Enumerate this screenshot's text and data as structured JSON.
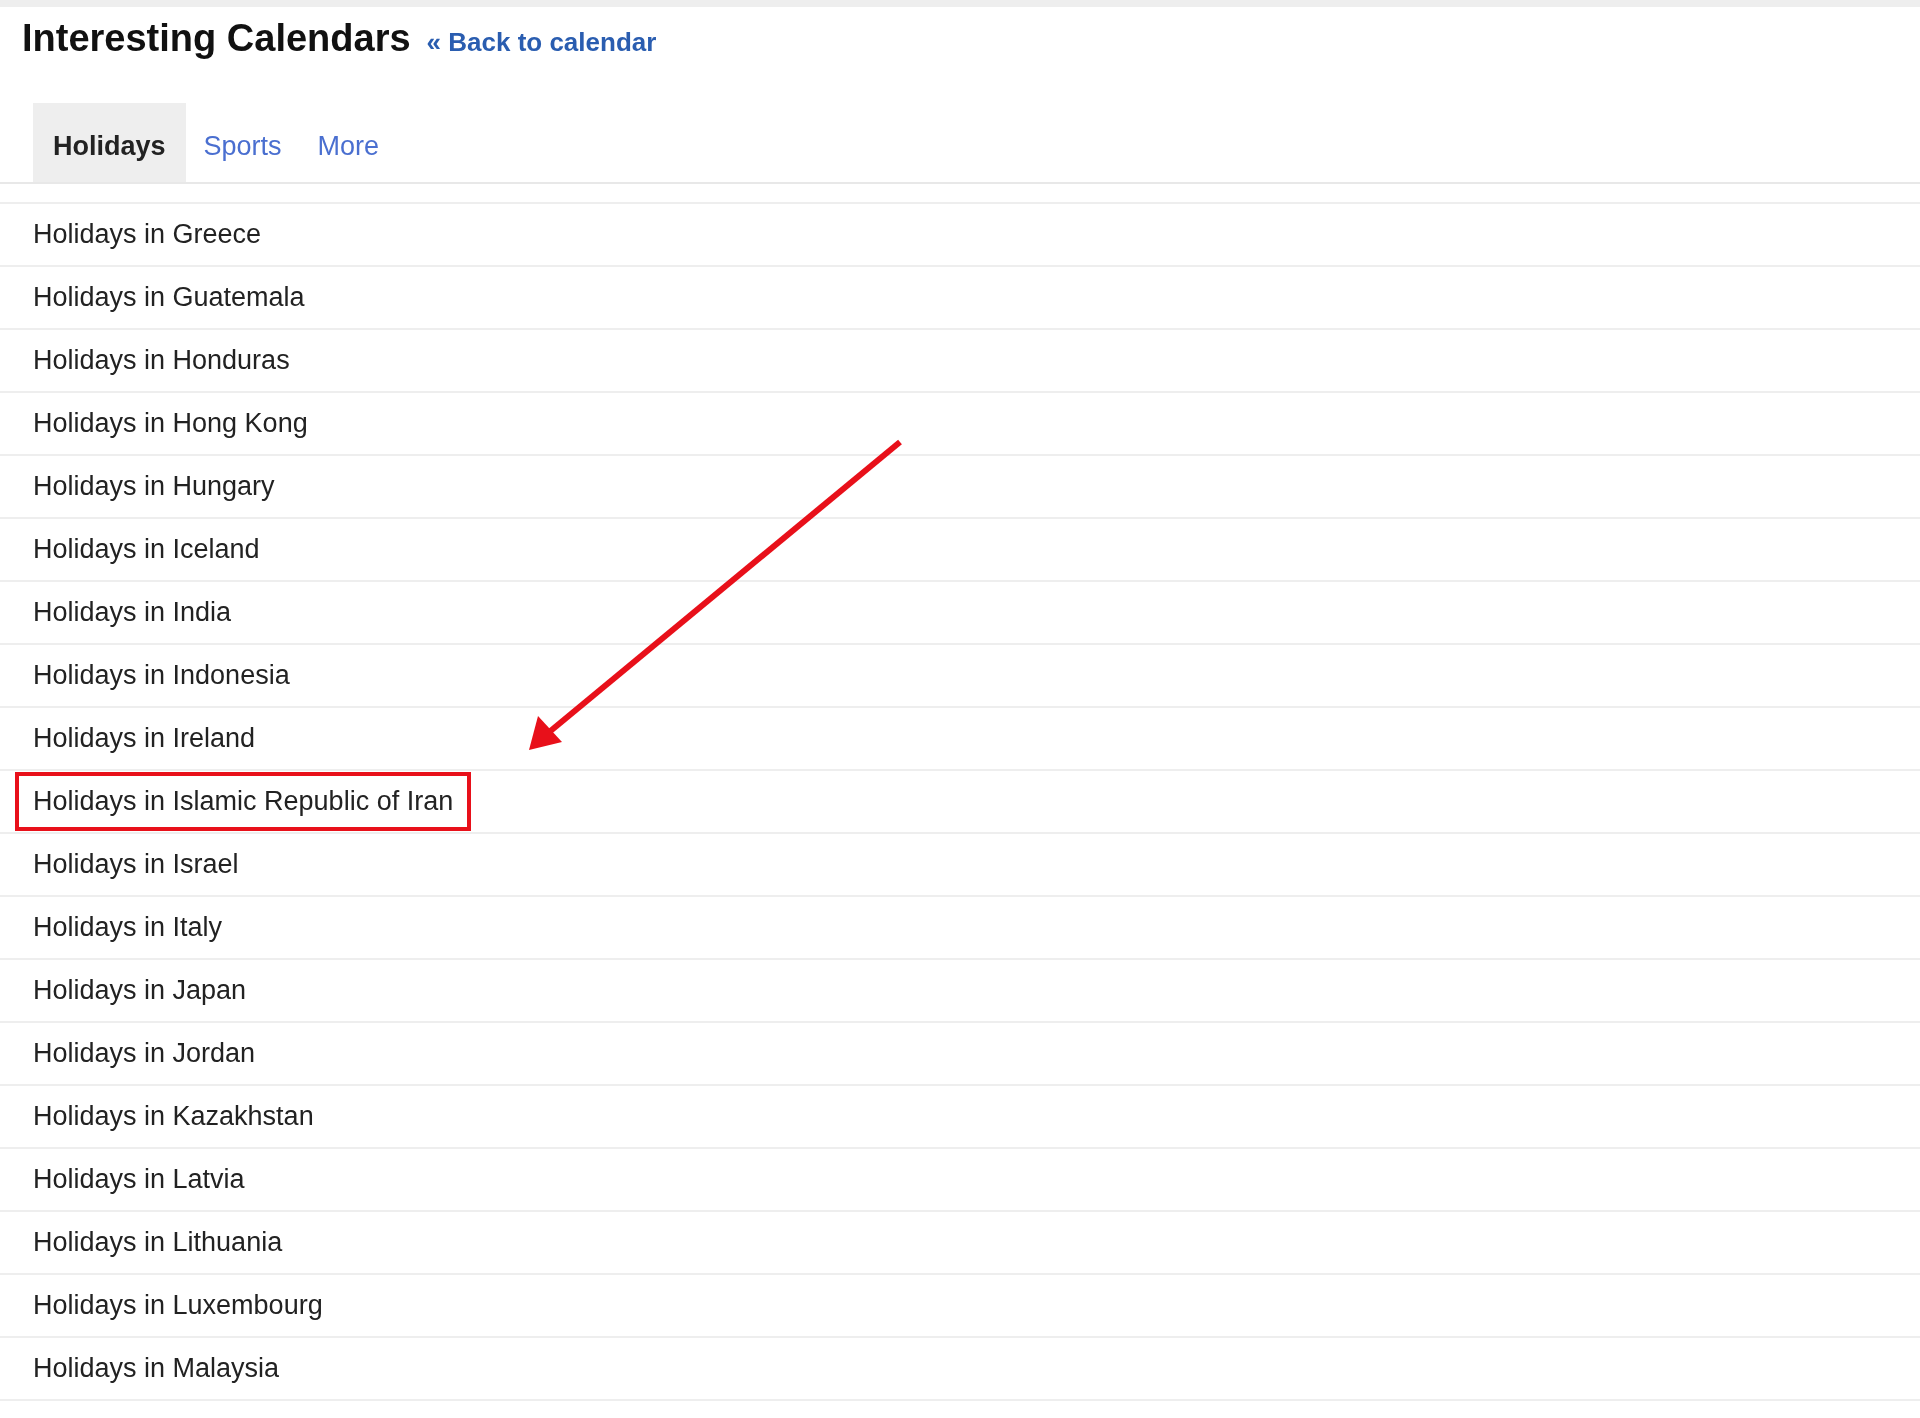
{
  "header": {
    "title": "Interesting Calendars",
    "back_link": "« Back to calendar"
  },
  "tabs": [
    {
      "label": "Holidays",
      "selected": true
    },
    {
      "label": "Sports",
      "selected": false
    },
    {
      "label": "More",
      "selected": false
    }
  ],
  "calendars": [
    {
      "name": "Holidays in Greece",
      "highlighted": false
    },
    {
      "name": "Holidays in Guatemala",
      "highlighted": false
    },
    {
      "name": "Holidays in Honduras",
      "highlighted": false
    },
    {
      "name": "Holidays in Hong Kong",
      "highlighted": false
    },
    {
      "name": "Holidays in Hungary",
      "highlighted": false
    },
    {
      "name": "Holidays in Iceland",
      "highlighted": false
    },
    {
      "name": "Holidays in India",
      "highlighted": false
    },
    {
      "name": "Holidays in Indonesia",
      "highlighted": false
    },
    {
      "name": "Holidays in Ireland",
      "highlighted": false
    },
    {
      "name": "Holidays in Islamic Republic of Iran",
      "highlighted": true
    },
    {
      "name": "Holidays in Israel",
      "highlighted": false
    },
    {
      "name": "Holidays in Italy",
      "highlighted": false
    },
    {
      "name": "Holidays in Japan",
      "highlighted": false
    },
    {
      "name": "Holidays in Jordan",
      "highlighted": false
    },
    {
      "name": "Holidays in Kazakhstan",
      "highlighted": false
    },
    {
      "name": "Holidays in Latvia",
      "highlighted": false
    },
    {
      "name": "Holidays in Lithuania",
      "highlighted": false
    },
    {
      "name": "Holidays in Luxembourg",
      "highlighted": false
    },
    {
      "name": "Holidays in Malaysia",
      "highlighted": false
    }
  ]
}
